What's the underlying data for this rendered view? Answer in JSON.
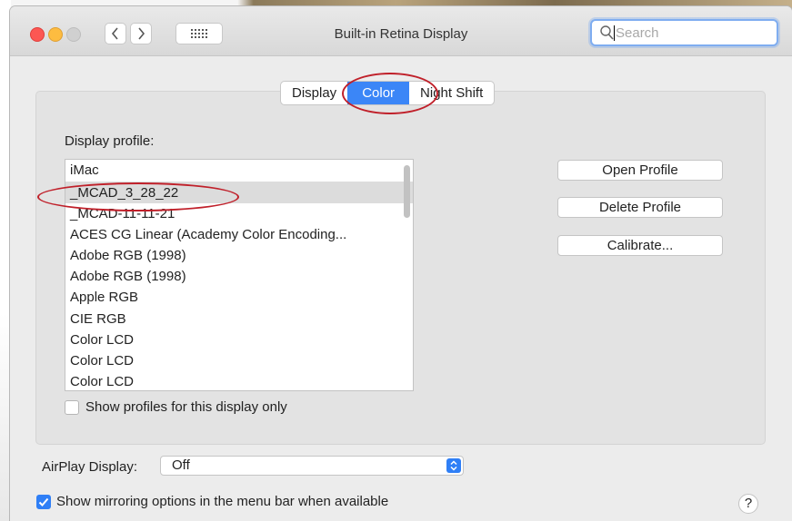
{
  "window": {
    "title": "Built-in Retina Display"
  },
  "search": {
    "placeholder": "Search"
  },
  "tabs": [
    {
      "label": "Display",
      "selected": false
    },
    {
      "label": "Color",
      "selected": true
    },
    {
      "label": "Night Shift",
      "selected": false
    }
  ],
  "profile": {
    "heading": "Display profile:",
    "items": [
      "iMac",
      "_MCAD_3_28_22",
      "_MCAD-11-11-21",
      "ACES CG Linear (Academy Color Encoding...",
      "Adobe RGB (1998)",
      "Adobe RGB (1998)",
      "Apple RGB",
      "CIE RGB",
      "Color LCD",
      "Color LCD",
      "Color LCD"
    ],
    "selected_index": 1,
    "show_only_label": "Show profiles for this display only",
    "show_only_checked": false
  },
  "buttons": {
    "open": "Open Profile",
    "delete": "Delete Profile",
    "calibrate": "Calibrate..."
  },
  "airplay": {
    "label": "AirPlay Display:",
    "value": "Off"
  },
  "mirroring": {
    "label": "Show mirroring options in the menu bar when available",
    "checked": true
  },
  "help": {
    "label": "?"
  },
  "annotation_color": "#c0202a",
  "accent_color": "#3b86f7"
}
